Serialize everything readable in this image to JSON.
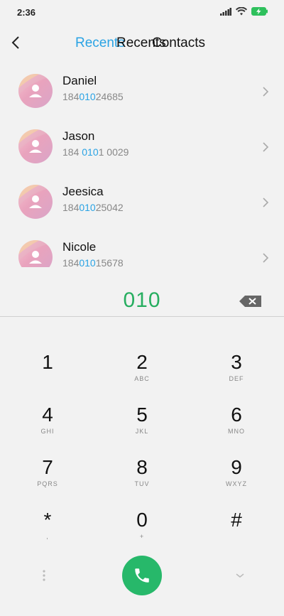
{
  "status_bar": {
    "time": "2:36",
    "icons": [
      "signal-icon",
      "wifi-icon",
      "battery-charging-icon"
    ]
  },
  "header": {
    "tabs": [
      {
        "label": "Recents",
        "active": true
      },
      {
        "label": "Recents",
        "active": false
      },
      {
        "label": "Contacts",
        "active": false
      }
    ],
    "back_icon": "back-arrow-icon"
  },
  "contacts": [
    {
      "name": "Daniel",
      "number_pre": "184",
      "number_hl": "010",
      "number_post": "24685"
    },
    {
      "name": "Jason",
      "number_pre": "184 ",
      "number_hl": "010",
      "number_post": "1 0029"
    },
    {
      "name": "Jeesica",
      "number_pre": "184",
      "number_hl": "010",
      "number_post": "25042"
    },
    {
      "name": "Nicole",
      "number_pre": "184",
      "number_hl": "010",
      "number_post": "15678"
    }
  ],
  "dialer": {
    "dialed_number": "010",
    "backspace_icon": "backspace-icon"
  },
  "keypad": {
    "keys": [
      {
        "digit": "1",
        "letters": ""
      },
      {
        "digit": "2",
        "letters": "ABC"
      },
      {
        "digit": "3",
        "letters": "DEF"
      },
      {
        "digit": "4",
        "letters": "GHI"
      },
      {
        "digit": "5",
        "letters": "JKL"
      },
      {
        "digit": "6",
        "letters": "MNO"
      },
      {
        "digit": "7",
        "letters": "PQRS"
      },
      {
        "digit": "8",
        "letters": "TUV"
      },
      {
        "digit": "9",
        "letters": "WXYZ"
      },
      {
        "digit": "*",
        "letters": ","
      },
      {
        "digit": "0",
        "letters": "+"
      },
      {
        "digit": "#",
        "letters": ""
      }
    ],
    "call_icon": "phone-icon",
    "more_icon": "more-vertical-icon",
    "collapse_icon": "chevron-down-icon"
  },
  "colors": {
    "accent": "#2aa3e4",
    "call_green": "#27b86a",
    "dialed_green": "#27ae60"
  }
}
